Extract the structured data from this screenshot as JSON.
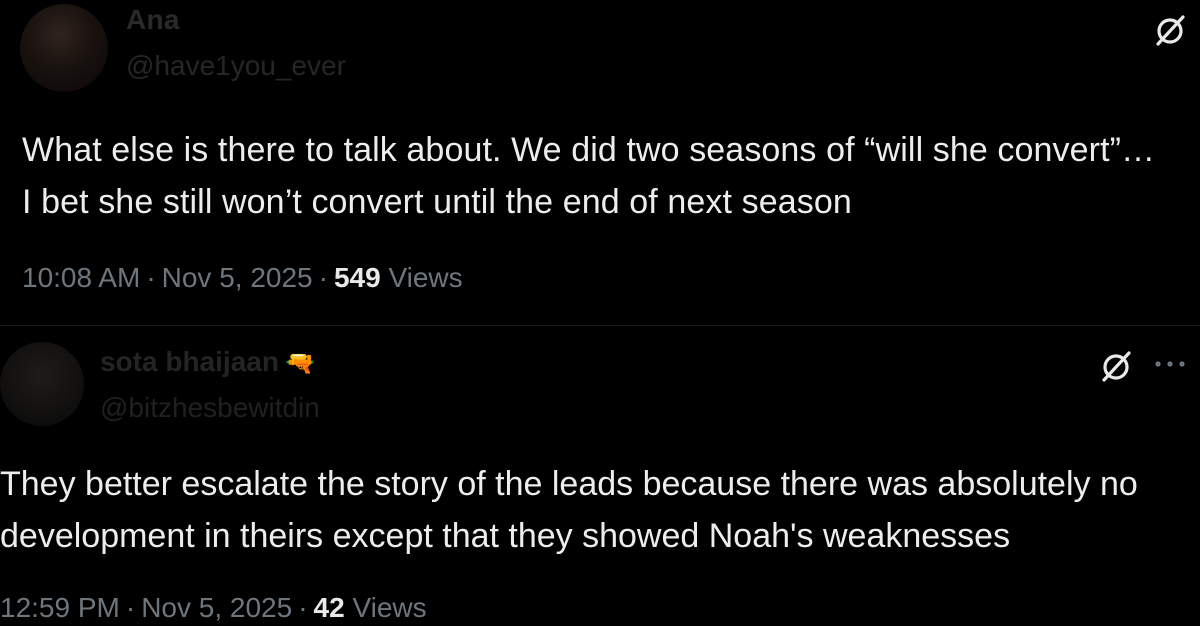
{
  "posts": [
    {
      "author_name": "Ana",
      "author_handle": "@have1you_ever",
      "text": "What else is there to talk about. We did two seasons of “will she convert”… I bet she still won’t convert until the end of next season",
      "time": "10:08 AM",
      "date": "Nov 5, 2025",
      "views_count": "549",
      "views_label": "Views",
      "icons": [
        "grok-icon"
      ]
    },
    {
      "author_name": "sota bhaijaan",
      "author_emoji": "🔫",
      "author_handle": "@bitzhesbewitdin",
      "text": "They better escalate the story of the leads because there was absolutely no development in theirs except that they showed Noah's weaknesses",
      "time": "12:59 PM",
      "date": "Nov 5, 2025",
      "views_count": "42",
      "views_label": "Views",
      "icons": [
        "grok-icon",
        "more-icon"
      ]
    }
  ],
  "meta_separator": "·",
  "colors": {
    "background": "#000000",
    "text": "#e7e9ea",
    "muted": "#6e767d"
  }
}
